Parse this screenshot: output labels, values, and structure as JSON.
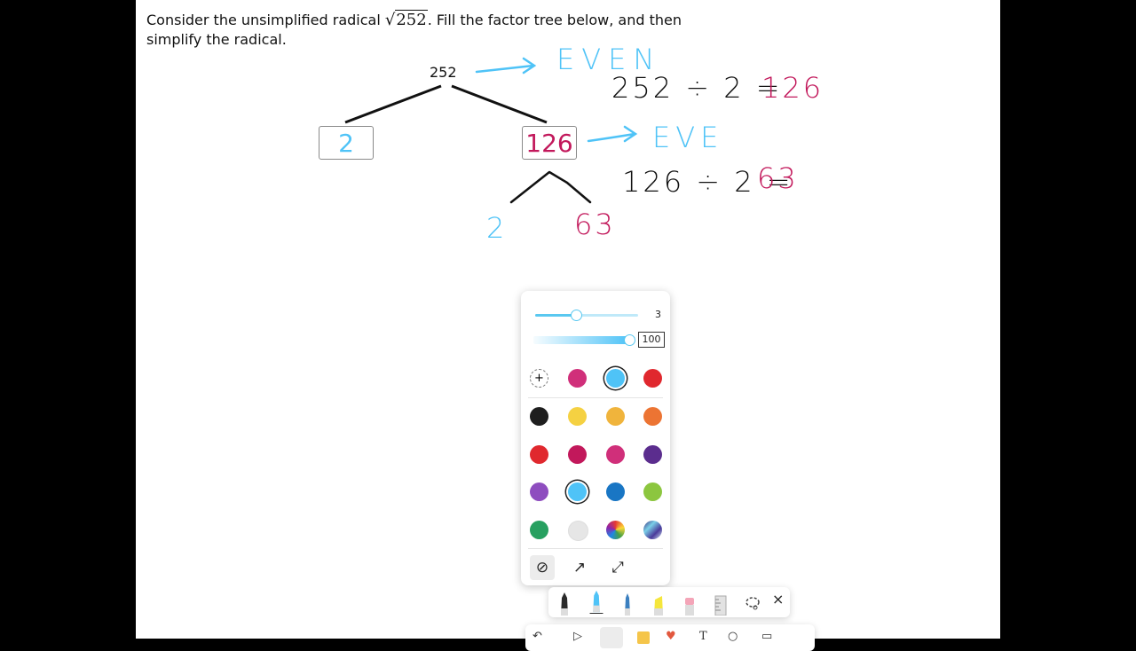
{
  "question": {
    "line1_before": "Consider the unsimplified radical ",
    "radical_symbol": "√",
    "radicand": "252",
    "line1_after": ". Fill the factor tree below, and then",
    "line2": "simplify the radical."
  },
  "tree": {
    "root": "252",
    "left_box": "2",
    "right_box": "126"
  },
  "ink": {
    "even1": "EVEN",
    "eq1_left": "252 ÷ 2 =",
    "eq1_right": "126",
    "even2": "EVE",
    "eq2_left": "126 ÷ 2 =",
    "eq2_right": "63",
    "branch_left": "2",
    "branch_right": "63",
    "colors": {
      "blue": "#4fc3f7",
      "magenta": "#c2185b",
      "black": "#111111"
    }
  },
  "pen_settings": {
    "thickness": "3",
    "opacity": "100",
    "thickness_fraction": 0.4,
    "opacity_fraction": 1.0
  },
  "palette": {
    "add_color_label": "+",
    "recent": [
      "#d02f7a",
      "#4fc3f7",
      "#e0282e"
    ],
    "selected_recent": 1,
    "rows": [
      [
        "#1e1e1e",
        "#f5d142",
        "#f0b43c",
        "#ec7433"
      ],
      [
        "#e0282e",
        "#c2185b",
        "#d02f7a",
        "#5b2d8e"
      ],
      [
        "#8e4dbf",
        "#4fc3f7",
        "#1976c4",
        "#8cc63f"
      ],
      [
        "#27a060",
        "#e6e6e6",
        "rainbow",
        "galaxy"
      ]
    ],
    "selected_cell": [
      2,
      1
    ],
    "tips": [
      "⊘",
      "↗",
      "⤢"
    ]
  },
  "toolbar": {
    "tools": [
      "pen-black",
      "pen-blue",
      "pen-blue-fine",
      "highlighter-yellow",
      "eraser",
      "ruler",
      "lasso"
    ],
    "close": "×"
  }
}
